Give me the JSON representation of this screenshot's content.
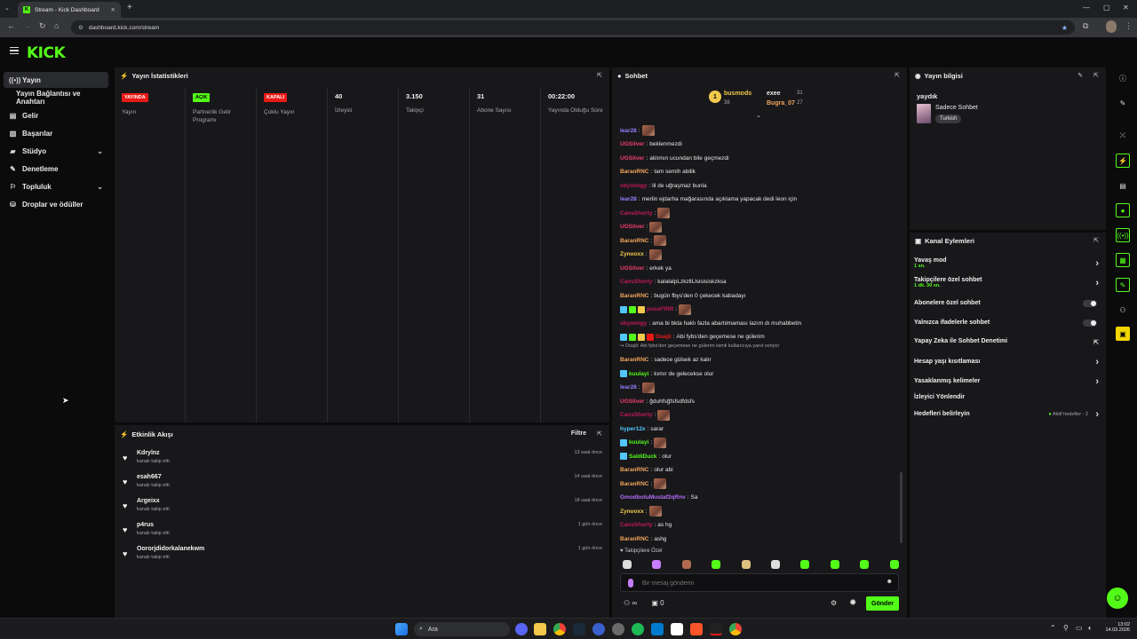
{
  "browser": {
    "tab_title": "Stream - Kick Dashboard",
    "url": "dashboard.kick.com/stream"
  },
  "brand": {
    "logo": "KICK",
    "accent": "#53fc18"
  },
  "sidebar": {
    "items": [
      {
        "label": "Yayın",
        "icon": "broadcast-icon"
      },
      {
        "label": "Yayın Bağlantısı ve Anahtarı",
        "icon": ""
      },
      {
        "label": "Gelir",
        "icon": "revenue-icon"
      },
      {
        "label": "Başarılar",
        "icon": "achievements-icon"
      },
      {
        "label": "Stüdyo",
        "icon": "studio-icon"
      },
      {
        "label": "Denetleme",
        "icon": "moderation-icon"
      },
      {
        "label": "Topluluk",
        "icon": "community-icon"
      },
      {
        "label": "Droplar ve ödüller",
        "icon": "drops-icon"
      }
    ]
  },
  "stats": {
    "title": "Yayın İstatistikleri",
    "cells": [
      {
        "value": "YAYINDA",
        "label": "Yayın",
        "kind": "badge-red"
      },
      {
        "value": "AÇIK",
        "label": "Partnerlik Gelir Programı",
        "kind": "badge-green"
      },
      {
        "value": "KAPALI",
        "label": "Çoklu Yayın",
        "kind": "badge-red"
      },
      {
        "value": "40",
        "label": "İzleyici",
        "kind": "number"
      },
      {
        "value": "3.150",
        "label": "Takipçi",
        "kind": "number"
      },
      {
        "value": "31",
        "label": "Abone Sayısı",
        "kind": "number"
      },
      {
        "value": "00:22:00",
        "label": "Yayında Olduğu Süre",
        "kind": "number"
      }
    ]
  },
  "activity": {
    "title": "Etkinlik Akışı",
    "filter_label": "Filtre",
    "items": [
      {
        "name": "Kdrylnz",
        "action": "kanalı takip etti",
        "time": "13 saat önce"
      },
      {
        "name": "esah667",
        "action": "kanalı takip etti",
        "time": "14 saat önce"
      },
      {
        "name": "Argeixx",
        "action": "kanalı takip etti",
        "time": "18 saat önce"
      },
      {
        "name": "p4rus",
        "action": "kanalı takip etti",
        "time": "1 gün önce"
      },
      {
        "name": "Oororjdidorkalanekwm",
        "action": "kanalı takip etti",
        "time": "1 gün önce"
      }
    ]
  },
  "chat": {
    "title": "Sohbet",
    "leaders": [
      {
        "name": "busmods",
        "count": "38"
      },
      {
        "name": "exee",
        "count": "31"
      },
      {
        "name": "Bugra_07",
        "count": "27"
      }
    ],
    "messages": [
      {
        "user": "lear28",
        "color": "#9b7cff",
        "text": "",
        "emote": true
      },
      {
        "user": "UGSilver",
        "color": "#f03e6e",
        "text": "beklenmezdi"
      },
      {
        "user": "UGSilver",
        "color": "#f03e6e",
        "text": "aklımın ucundan bile geçmezdi"
      },
      {
        "user": "BaranRNC",
        "color": "#f2a65a",
        "text": "tam semih abilik"
      },
      {
        "user": "sbyomigy",
        "color": "#c2185b",
        "text": "lil de uğraşmaz bunla"
      },
      {
        "user": "lear28",
        "color": "#9b7cff",
        "text": "merlin ejdarha mağarasında açıklama yapacak dedi leon için"
      },
      {
        "user": "CansShorty",
        "color": "#c2185b",
        "text": "",
        "emote": true
      },
      {
        "user": "UGSilver",
        "color": "#f03e6e",
        "text": "",
        "emote": true
      },
      {
        "user": "BaranRNC",
        "color": "#f2a65a",
        "text": "",
        "emote": true
      },
      {
        "user": "Zynooxx",
        "color": "#f2c94c",
        "text": "",
        "emote": true
      },
      {
        "user": "UGSilver",
        "color": "#f03e6e",
        "text": "erkek ya"
      },
      {
        "user": "CansShorty",
        "color": "#c2185b",
        "text": "kalalalpLzkzllLlsisisiskzksa"
      },
      {
        "user": "BaranRNC",
        "color": "#f2a65a",
        "text": "bugün fbys'den 0 çekecek kabadayı"
      },
      {
        "user": "pussFIRR",
        "color": "#c2185b",
        "text": "",
        "emote": true,
        "badges": 3
      },
      {
        "user": "sbyomigy",
        "color": "#c2185b",
        "text": "ama bi bkta haklı fazla abartılmaması lazım dı muhabbetin"
      },
      {
        "user": "Doajli",
        "color": "#e91916",
        "text": "Abi fybs'den geçemese ne gülerim",
        "badges": 4
      },
      {
        "user": "",
        "color": "#a7a7ab",
        "text": "↪ Doajli: Abi fybs'den geçemese ne gülerim isimli kullanıcıya yanıt veriyor",
        "reply": true
      },
      {
        "user": "BaranRNC",
        "color": "#f2a65a",
        "text": "sadece gülsek az kalır"
      },
      {
        "user": "kuulayi",
        "color": "#53fc18",
        "text": "kımır de gelecekse olur",
        "badges": 1
      },
      {
        "user": "lear28",
        "color": "#9b7cff",
        "text": "",
        "emote": true
      },
      {
        "user": "UGSilver",
        "color": "#f03e6e",
        "text": "ğduhfsğfsfsdfdsfs"
      },
      {
        "user": "CansShorty",
        "color": "#c2185b",
        "text": "",
        "emote": true
      },
      {
        "user": "hyper12x",
        "color": "#53c7fc",
        "text": "sarar"
      },
      {
        "user": "kuulayi",
        "color": "#53fc18",
        "text": "",
        "emote": true,
        "badges": 1
      },
      {
        "user": "SaldiDuck",
        "color": "#53fc18",
        "text": "olur",
        "badges": 1
      },
      {
        "user": "BaranRNC",
        "color": "#f2a65a",
        "text": "olur abi"
      },
      {
        "user": "BaranRNC",
        "color": "#f2a65a",
        "text": "",
        "emote": true
      },
      {
        "user": "GmodbotuMustaf2qRnv",
        "color": "#b26df7",
        "text": "Sa"
      },
      {
        "user": "Zynooxx",
        "color": "#f2c94c",
        "text": "",
        "emote": true
      },
      {
        "user": "CansShorty",
        "color": "#c2185b",
        "text": "as hg"
      },
      {
        "user": "BaranRNC",
        "color": "#f2a65a",
        "text": "ashg"
      }
    ],
    "followers_only_label": "Takipçilere Özel",
    "input_placeholder": "Bir mesaj gönderin",
    "infinity_label": "∞",
    "count_label": "0",
    "send_label": "Gönder"
  },
  "stream_info": {
    "title": "Yayın bilgisi",
    "stream_title": "yaydık",
    "category": "Sadece Sohbet",
    "tag": "Turkish"
  },
  "channel_actions": {
    "title": "Kanal Eylemleri",
    "items": [
      {
        "label": "Yavaş mod",
        "sub": "1 sn.",
        "control": "chevron"
      },
      {
        "label": "Takipçilere özel sohbet",
        "sub": "1 dk. 30 sn.",
        "control": "chevron"
      },
      {
        "label": "Abonelere özel sohbet",
        "sub": "",
        "control": "toggle"
      },
      {
        "label": "Yalnızca ifadelerle sohbet",
        "sub": "",
        "control": "toggle"
      },
      {
        "label": "Yapay Zeka ile Sohbet Denetimi",
        "sub": "",
        "control": "popout"
      },
      {
        "label": "Hesap yaşı kısıtlaması",
        "sub": "",
        "control": "chevron"
      },
      {
        "label": "Yasaklanmış kelimeler",
        "sub": "",
        "control": "chevron"
      },
      {
        "label": "İzleyici Yönlendir",
        "sub": "",
        "control": "none"
      },
      {
        "label": "Hedefleri belirleyin",
        "sub": "",
        "control": "chevron",
        "extra": "Aktif hedefler - 2"
      }
    ]
  },
  "taskbar": {
    "search_label": "Ara",
    "time": "13:02",
    "date": "14.03.2026"
  }
}
